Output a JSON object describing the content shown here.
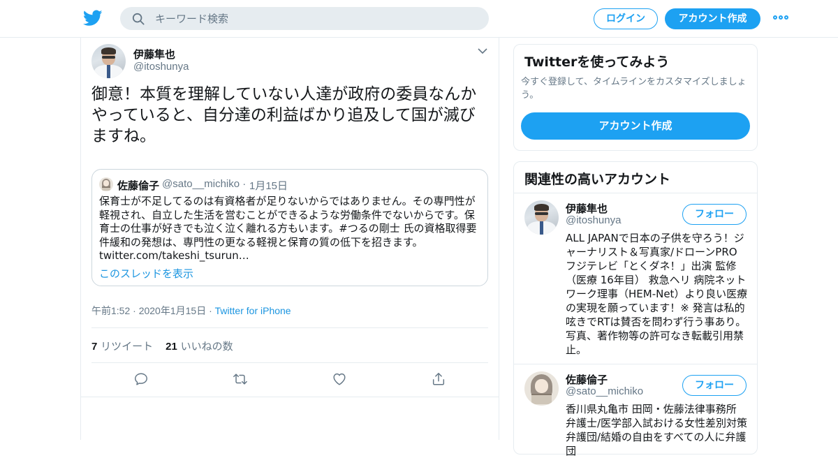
{
  "header": {
    "search_placeholder": "キーワード検索",
    "login_label": "ログイン",
    "signup_label": "アカウント作成",
    "accent_color": "#1da1f2"
  },
  "tweet": {
    "author_name": "伊藤隼也",
    "author_handle": "@itoshunya",
    "text": "御意！本質を理解していない人達が政府の委員なんかやっていると、自分達の利益ばかり追及して国が滅びますね。",
    "quoted": {
      "author_name": "佐藤倫子",
      "author_handle": "@sato__michiko",
      "separator": "·",
      "date": "1月15日",
      "text": "保育士が不足してるのは有資格者が足りないからではありません。その専門性が軽視され、自立した生活を営むことができるような労働条件でないからです。保育士の仕事が好きでも泣く泣く離れる方もいます。#つるの剛士 氏の資格取得要件緩和の発想は、専門性の更なる軽視と保育の質の低下を招きます。twitter.com/takeshi_tsurun…",
      "thread_link": "このスレッドを表示"
    },
    "timestamp": "午前1:52 · 2020年1月15日",
    "meta_separator": "·",
    "source": "Twitter for iPhone",
    "retweet_count": "7",
    "retweet_label": "リツイート",
    "like_count": "21",
    "like_label": "いいねの数"
  },
  "sidebar": {
    "signup_card": {
      "title": "Twitterを使ってみよう",
      "description": "今すぐ登録して、タイムラインをカスタマイズしましょう。",
      "button_label": "アカウント作成"
    },
    "related": {
      "title": "関連性の高いアカウント",
      "accounts": [
        {
          "name": "伊藤隼也",
          "handle": "@itoshunya",
          "follow_label": "フォロー",
          "bio": "ALL JAPANで日本の子供を守ろう！ジャーナリスト＆写真家/ドローンPRO フジテレビ「とくダネ！」出演 監修（医療 16年目） 救急ヘリ 病院ネットワーク理事（HEM-Net）より良い医療の実現を願っています！※ 発言は私的呟きでRTは賛否を問わず行う事あり。写真、著作物等の許可なき転載引用禁止。"
        },
        {
          "name": "佐藤倫子",
          "handle": "@sato__michiko",
          "follow_label": "フォロー",
          "bio": "香川県丸亀市 田岡・佐藤法律事務所 弁護士/医学部入試おける女性差別対策弁護団/結婚の自由をすべての人に弁護団"
        }
      ]
    }
  }
}
